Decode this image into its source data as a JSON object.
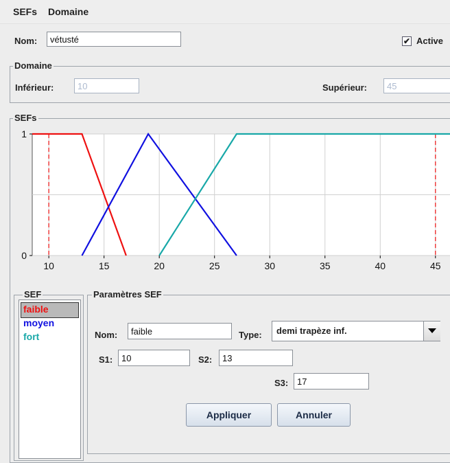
{
  "menu": {
    "items": [
      "SEFs",
      "Domaine"
    ]
  },
  "header": {
    "nom_label": "Nom:",
    "nom_value": "vétusté",
    "active_label": "Active",
    "active_mark": "✔"
  },
  "domaine": {
    "title": "Domaine",
    "inf_label": "Inférieur:",
    "inf_value": "10",
    "sup_label": "Supérieur:",
    "sup_value": "45"
  },
  "sefs_panel": {
    "title": "SEFs"
  },
  "chart_data": {
    "type": "line",
    "xlim": [
      8.5,
      47
    ],
    "ylim": [
      0,
      1
    ],
    "x_ticks": [
      10,
      15,
      20,
      25,
      30,
      35,
      40,
      45
    ],
    "y_ticks": [
      0,
      1
    ],
    "grid": true,
    "bounds": [
      10,
      45
    ],
    "series": [
      {
        "name": "faible",
        "color": "#ee1111",
        "points": [
          [
            8.5,
            1
          ],
          [
            13,
            1
          ],
          [
            17,
            0
          ]
        ]
      },
      {
        "name": "moyen",
        "color": "#1010e0",
        "points": [
          [
            13,
            0
          ],
          [
            19,
            1
          ],
          [
            27,
            0
          ]
        ]
      },
      {
        "name": "fort",
        "color": "#18a8a8",
        "points": [
          [
            20,
            0
          ],
          [
            27,
            1
          ],
          [
            47,
            1
          ]
        ]
      }
    ]
  },
  "sef_list": {
    "title": "SEF",
    "items": [
      {
        "label": "faible",
        "color": "#ee1111",
        "selected": true
      },
      {
        "label": "moyen",
        "color": "#1010e0",
        "selected": false
      },
      {
        "label": "fort",
        "color": "#18a8a8",
        "selected": false
      }
    ]
  },
  "params": {
    "title": "Paramètres SEF",
    "nom_label": "Nom:",
    "nom_value": "faible",
    "type_label": "Type:",
    "type_value": "demi trapèze inf.",
    "s1_label": "S1:",
    "s1_value": "10",
    "s2_label": "S2:",
    "s2_value": "13",
    "s3_label": "S3:",
    "s3_value": "17",
    "apply_label": "Appliquer",
    "cancel_label": "Annuler"
  }
}
